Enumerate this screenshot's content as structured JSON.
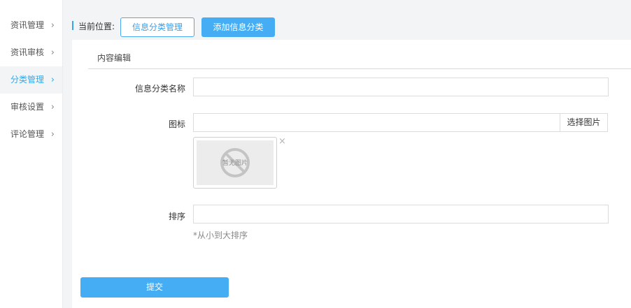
{
  "sidebar": {
    "items": [
      {
        "label": "资讯管理",
        "active": false
      },
      {
        "label": "资讯审核",
        "active": false
      },
      {
        "label": "分类管理",
        "active": true
      },
      {
        "label": "审核设置",
        "active": false
      },
      {
        "label": "评论管理",
        "active": false
      }
    ],
    "chevron": "›"
  },
  "breadcrumb": {
    "label": "当前位置:",
    "current_button": "信息分类管理",
    "action_button": "添加信息分类"
  },
  "section": {
    "title": "内容编辑"
  },
  "form": {
    "name_label": "信息分类名称",
    "name_value": "",
    "icon_label": "图标",
    "icon_value": "",
    "select_image_button": "选择图片",
    "no_image_text": "暂无图片",
    "remove_glyph": "×",
    "order_label": "排序",
    "order_value": "",
    "order_hint": "*从小到大排序",
    "submit_button": "提交"
  },
  "colors": {
    "accent": "#45adf3",
    "sidebar_active_text": "#32a8e8",
    "main_bg": "#f3f4f6"
  }
}
